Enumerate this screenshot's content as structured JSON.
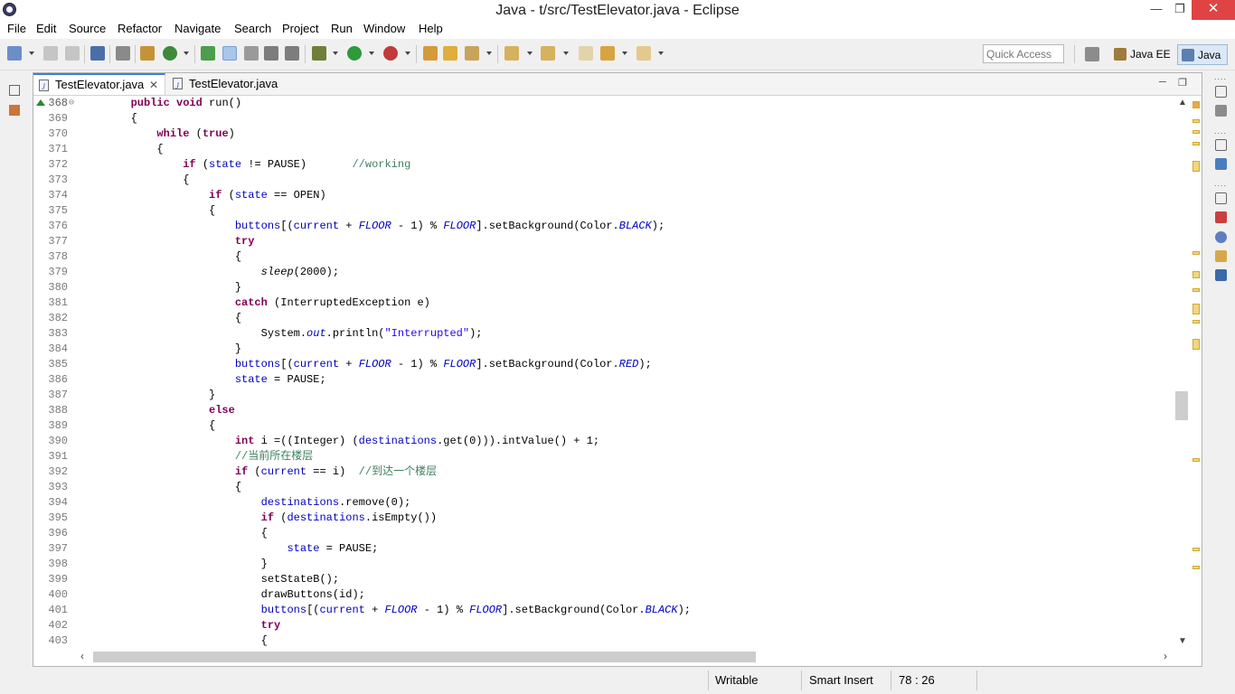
{
  "window": {
    "title": "Java - t/src/TestElevator.java - Eclipse"
  },
  "menu": [
    "File",
    "Edit",
    "Source",
    "Refactor",
    "Navigate",
    "Search",
    "Project",
    "Run",
    "Window",
    "Help"
  ],
  "toolbar": {
    "quick_access_placeholder": "Quick Access",
    "perspectives": [
      {
        "label": "Java EE",
        "active": false
      },
      {
        "label": "Java",
        "active": true
      }
    ]
  },
  "editor": {
    "tabs": [
      {
        "label": "TestElevator.java",
        "active": true
      },
      {
        "label": "TestElevator.java",
        "active": false
      }
    ],
    "lines": [
      {
        "n": "368",
        "t": [
          [
            "        "
          ],
          [
            "public",
            "kw"
          ],
          [
            " "
          ],
          [
            "void",
            "kw"
          ],
          [
            " run()"
          ]
        ]
      },
      {
        "n": "369",
        "t": [
          [
            "        {"
          ]
        ]
      },
      {
        "n": "370",
        "t": [
          [
            "            "
          ],
          [
            "while",
            "kw"
          ],
          [
            " ("
          ],
          [
            "true",
            "kw"
          ],
          [
            ")"
          ]
        ]
      },
      {
        "n": "371",
        "t": [
          [
            "            {"
          ]
        ]
      },
      {
        "n": "372",
        "t": [
          [
            "                "
          ],
          [
            "if",
            "kw"
          ],
          [
            " ("
          ],
          [
            "state",
            "fld"
          ],
          [
            " != PAUSE)       "
          ],
          [
            "//working",
            "cm"
          ]
        ]
      },
      {
        "n": "373",
        "t": [
          [
            "                {"
          ]
        ]
      },
      {
        "n": "374",
        "t": [
          [
            "                    "
          ],
          [
            "if",
            "kw"
          ],
          [
            " ("
          ],
          [
            "state",
            "fld"
          ],
          [
            " == OPEN)"
          ]
        ]
      },
      {
        "n": "375",
        "t": [
          [
            "                    {"
          ]
        ]
      },
      {
        "n": "376",
        "t": [
          [
            "                        "
          ],
          [
            "buttons",
            "fld"
          ],
          [
            "[("
          ],
          [
            "current",
            "fld"
          ],
          [
            " + "
          ],
          [
            "FLOOR",
            "sfld"
          ],
          [
            " - 1) % "
          ],
          [
            "FLOOR",
            "sfld"
          ],
          [
            "].setBackground(Color."
          ],
          [
            "BLACK",
            "sfld"
          ],
          [
            ");"
          ]
        ]
      },
      {
        "n": "377",
        "t": [
          [
            "                        "
          ],
          [
            "try",
            "kw"
          ]
        ]
      },
      {
        "n": "378",
        "t": [
          [
            "                        {"
          ]
        ]
      },
      {
        "n": "379",
        "t": [
          [
            "                            "
          ],
          [
            "sleep",
            "smeth"
          ],
          [
            "(2000);"
          ]
        ]
      },
      {
        "n": "380",
        "t": [
          [
            "                        }"
          ]
        ]
      },
      {
        "n": "381",
        "t": [
          [
            "                        "
          ],
          [
            "catch",
            "kw"
          ],
          [
            " (InterruptedException e)"
          ]
        ]
      },
      {
        "n": "382",
        "t": [
          [
            "                        {"
          ]
        ]
      },
      {
        "n": "383",
        "t": [
          [
            "                            System."
          ],
          [
            "out",
            "sfld"
          ],
          [
            ".println("
          ],
          [
            "\"Interrupted\"",
            "str"
          ],
          [
            ");"
          ]
        ]
      },
      {
        "n": "384",
        "t": [
          [
            "                        }"
          ]
        ]
      },
      {
        "n": "385",
        "t": [
          [
            "                        "
          ],
          [
            "buttons",
            "fld"
          ],
          [
            "[("
          ],
          [
            "current",
            "fld"
          ],
          [
            " + "
          ],
          [
            "FLOOR",
            "sfld"
          ],
          [
            " - 1) % "
          ],
          [
            "FLOOR",
            "sfld"
          ],
          [
            "].setBackground(Color."
          ],
          [
            "RED",
            "sfld"
          ],
          [
            ");"
          ]
        ]
      },
      {
        "n": "386",
        "t": [
          [
            "                        "
          ],
          [
            "state",
            "fld"
          ],
          [
            " = PAUSE;"
          ]
        ]
      },
      {
        "n": "387",
        "t": [
          [
            "                    }"
          ]
        ]
      },
      {
        "n": "388",
        "t": [
          [
            "                    "
          ],
          [
            "else",
            "kw"
          ]
        ]
      },
      {
        "n": "389",
        "t": [
          [
            "                    {"
          ]
        ]
      },
      {
        "n": "390",
        "t": [
          [
            "                        "
          ],
          [
            "int",
            "kw"
          ],
          [
            " i =((Integer) ("
          ],
          [
            "destinations",
            "fld"
          ],
          [
            ".get(0))).intValue() + 1;"
          ]
        ]
      },
      {
        "n": "391",
        "t": [
          [
            "                        "
          ],
          [
            "//当前所在楼层",
            "cm"
          ]
        ]
      },
      {
        "n": "392",
        "t": [
          [
            "                        "
          ],
          [
            "if",
            "kw"
          ],
          [
            " ("
          ],
          [
            "current",
            "fld"
          ],
          [
            " == i)  "
          ],
          [
            "//到达一个楼层",
            "cm"
          ]
        ]
      },
      {
        "n": "393",
        "t": [
          [
            "                        {"
          ]
        ]
      },
      {
        "n": "394",
        "t": [
          [
            "                            "
          ],
          [
            "destinations",
            "fld"
          ],
          [
            ".remove(0);"
          ]
        ]
      },
      {
        "n": "395",
        "t": [
          [
            "                            "
          ],
          [
            "if",
            "kw"
          ],
          [
            " ("
          ],
          [
            "destinations",
            "fld"
          ],
          [
            ".isEmpty())"
          ]
        ]
      },
      {
        "n": "396",
        "t": [
          [
            "                            {"
          ]
        ]
      },
      {
        "n": "397",
        "t": [
          [
            "                                "
          ],
          [
            "state",
            "fld"
          ],
          [
            " = PAUSE;"
          ]
        ]
      },
      {
        "n": "398",
        "t": [
          [
            "                            }"
          ]
        ]
      },
      {
        "n": "399",
        "t": [
          [
            "                            setStateB();"
          ]
        ]
      },
      {
        "n": "400",
        "t": [
          [
            "                            drawButtons(id);"
          ]
        ]
      },
      {
        "n": "401",
        "t": [
          [
            "                            "
          ],
          [
            "buttons",
            "fld"
          ],
          [
            "[("
          ],
          [
            "current",
            "fld"
          ],
          [
            " + "
          ],
          [
            "FLOOR",
            "sfld"
          ],
          [
            " - 1) % "
          ],
          [
            "FLOOR",
            "sfld"
          ],
          [
            "].setBackground(Color."
          ],
          [
            "BLACK",
            "sfld"
          ],
          [
            ");"
          ]
        ]
      },
      {
        "n": "402",
        "t": [
          [
            "                            "
          ],
          [
            "try",
            "kw"
          ]
        ]
      },
      {
        "n": "403",
        "t": [
          [
            "                            {"
          ]
        ]
      }
    ]
  },
  "status": {
    "writable": "Writable",
    "insert_mode": "Smart Insert",
    "position": "78 : 26"
  },
  "colors": {
    "keyword": "#7f0055",
    "field": "#0000c0",
    "comment": "#3f7f5f",
    "string": "#2a00ff",
    "accent": "#3d7fd6"
  }
}
